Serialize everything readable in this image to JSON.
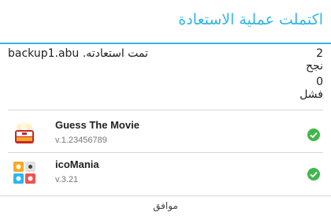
{
  "dialog": {
    "title": "اكتملت عملية الاستعادة",
    "accent_color": "#33b5e5"
  },
  "summary": {
    "file_name": "backup1.abu",
    "restored_label": ".تمت استعادته",
    "success_count": "2",
    "success_label": "نجح",
    "fail_count": "0",
    "fail_label": "فشل"
  },
  "apps": [
    {
      "name": "Guess The Movie",
      "version": "v.1.23456789",
      "icon": "guess-the-movie-icon",
      "status": "success"
    },
    {
      "name": "icoMania",
      "version": "v.3.21",
      "icon": "icomania-icon",
      "status": "success"
    }
  ],
  "status_color": "#3fb84a",
  "footer": {
    "ok_label": "موافق"
  }
}
